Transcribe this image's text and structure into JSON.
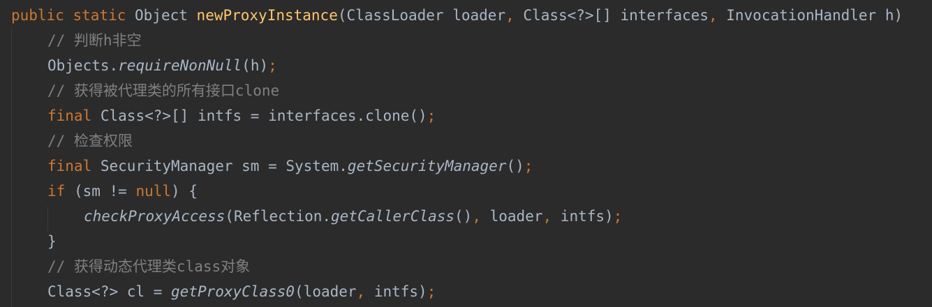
{
  "code": {
    "line1": {
      "kw_public": "public",
      "kw_static": "static",
      "type_object": "Object",
      "method_name": "newProxyInstance",
      "paren_open": "(",
      "type_classloader": "ClassLoader",
      "param_loader": "loader",
      "comma1": ",",
      "type_class_array": "Class<?>[]",
      "param_interfaces": "interfaces",
      "comma2": ",",
      "type_handler": "InvocationHandler",
      "param_h": "h)"
    },
    "line2": {
      "comment": "// 判断h非空"
    },
    "line3": {
      "objects": "Objects.",
      "require": "requireNonNull",
      "args": "(h)",
      "semi": ";"
    },
    "line4": {
      "comment": "// 获得被代理类的所有接口clone"
    },
    "line5": {
      "kw_final": "final",
      "decl": "Class<?>[] intfs = interfaces.clone()",
      "semi": ";"
    },
    "line6": {
      "comment": "// 检查权限"
    },
    "line7": {
      "kw_final": "final",
      "decl": "SecurityManager sm = System.",
      "call": "getSecurityManager",
      "tail": "()",
      "semi": ";"
    },
    "line8": {
      "kw_if": "if",
      "cond_a": "(sm != ",
      "kw_null": "null",
      "cond_b": ") {"
    },
    "line9": {
      "call": "checkProxyAccess",
      "arg_a": "(Reflection.",
      "call2": "getCallerClass",
      "arg_b": "()",
      "comma1": ",",
      "arg_c": " loader",
      "comma2": ",",
      "arg_d": " intfs)",
      "semi": ";"
    },
    "line10": {
      "brace": "}"
    },
    "line11": {
      "comment": "// 获得动态代理类class对象"
    },
    "line12": {
      "decl": "Class<?> cl = ",
      "call": "getProxyClass0",
      "arg_a": "(loader",
      "comma": ",",
      "arg_b": " intfs)",
      "semi": ";"
    }
  }
}
